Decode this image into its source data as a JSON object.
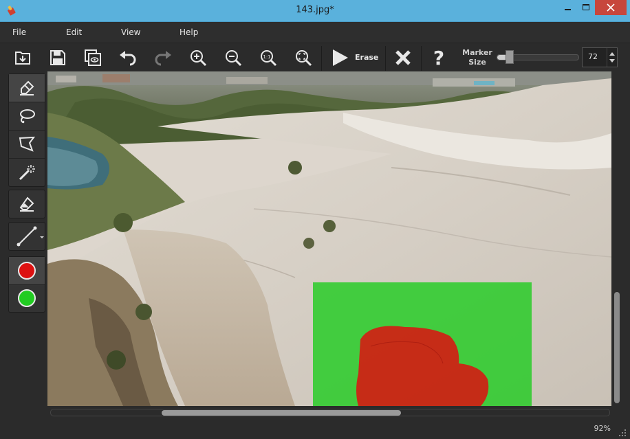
{
  "window": {
    "title": "143.jpg*"
  },
  "menu": [
    "File",
    "Edit",
    "View",
    "Help"
  ],
  "toolbar": {
    "buttons": [
      "open-icon",
      "save-icon",
      "save-as-icon",
      "undo-icon",
      "redo-icon",
      "zoom-in-icon",
      "zoom-out-icon",
      "zoom-1to1-icon",
      "zoom-fit-icon"
    ],
    "erase_label": "Erase",
    "marker_size_label": "Marker Size",
    "marker_size_value": "72",
    "marker_size_slider_fraction": 0.15
  },
  "tools": [
    "marker-icon",
    "lasso-icon",
    "polygon-lasso-icon",
    "magic-wand-icon",
    "eraser-icon",
    "line-icon"
  ],
  "colors": {
    "remove": "#dd1111",
    "keep": "#22cc22",
    "titlebar": "#5ab1dc"
  },
  "status": {
    "zoom": "92%"
  }
}
